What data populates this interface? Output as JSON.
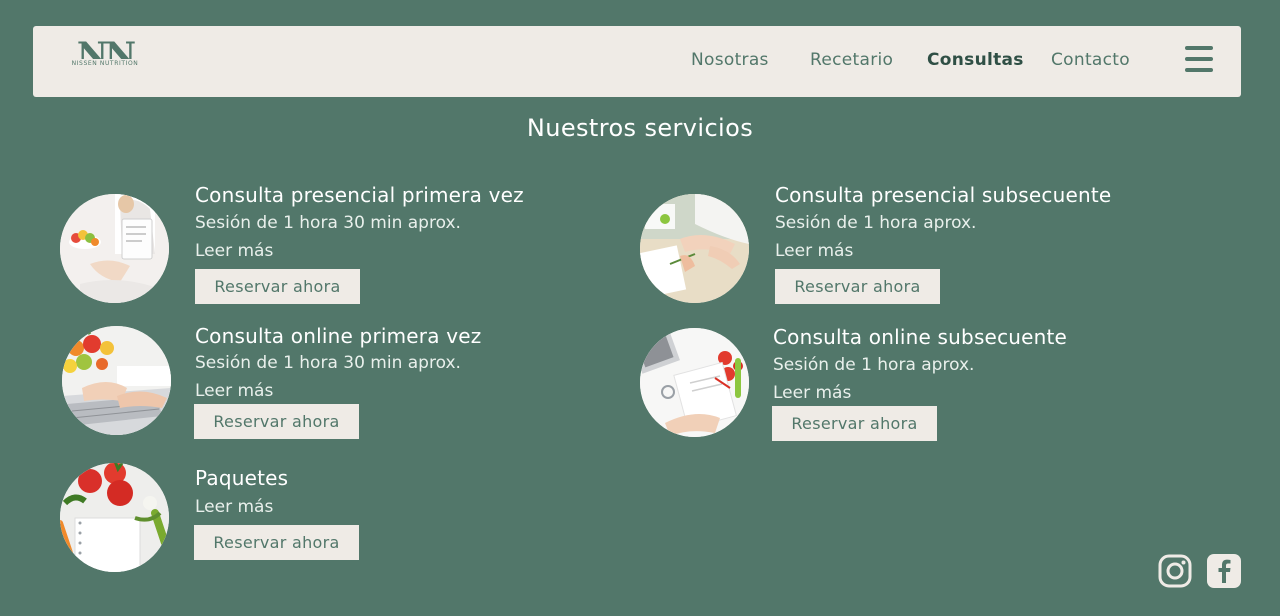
{
  "brand": {
    "logo_letters": "NN",
    "logo_text": "NISSEN NUTRITION"
  },
  "nav": {
    "items": [
      {
        "label": "Nosotras"
      },
      {
        "label": "Recetario"
      },
      {
        "label": "Consultas"
      },
      {
        "label": "Contacto"
      }
    ],
    "active": "Consultas",
    "menu_icon": "hamburger-menu-icon"
  },
  "page": {
    "title": "Nuestros servicios"
  },
  "services": [
    {
      "title": "Consulta presencial primera vez",
      "subtitle": "Sesión de 1 hora 30 min aprox.",
      "link": "Leer más",
      "button": "Reservar ahora",
      "image": "nutritionist-consultation-image"
    },
    {
      "title": "Consulta presencial subsecuente",
      "subtitle": "Sesión de 1 hora aprox.",
      "link": "Leer más",
      "button": "Reservar ahora",
      "image": "desk-notes-image"
    },
    {
      "title": "Consulta online primera vez",
      "subtitle": "Sesión de 1 hora 30 min aprox.",
      "link": "Leer más",
      "button": "Reservar ahora",
      "image": "laptop-fruits-image"
    },
    {
      "title": "Consulta online subsecuente",
      "subtitle": "Sesión de 1 hora aprox.",
      "link": "Leer más",
      "button": "Reservar ahora",
      "image": "tablet-tomatoes-image"
    },
    {
      "title": "Paquetes",
      "link": "Leer más",
      "button": "Reservar ahora",
      "image": "vegetables-notebook-image"
    }
  ],
  "social": [
    {
      "name": "instagram-icon"
    },
    {
      "name": "facebook-icon"
    }
  ],
  "colors": {
    "background": "#52776a",
    "navbar": "#efebe6",
    "accent": "#52776a"
  }
}
